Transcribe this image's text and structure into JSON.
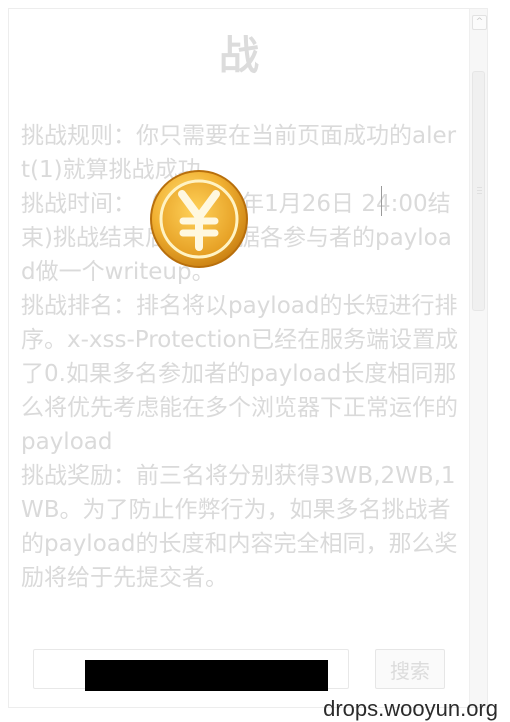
{
  "page": {
    "title": "战",
    "rules_text": "挑战规则：你只需要在当前页面成功的alert(1)就算挑战成功。\n挑战时间：  (于2014年1月26日 24:00结束)挑战结束后，将根据各参与者的payload做一个writeup。\n挑战排名：排名将以payload的长短进行排序。x-xss-Protection已经在服务端设置成了0.如果多名参加者的payload长度相同那么将优先考虑能在多个浏览器下正常运作的payload\n挑战奖励：前三名将分别获得3WB,2WB,1WB。为了防止作弊行为，如果多名挑战者的payload的长度和内容完全相同，那么奖励将给于先提交者。"
  },
  "search": {
    "value": "",
    "placeholder": "",
    "button_label": "搜索"
  },
  "watermark": "drops.wooyun.org",
  "icons": {
    "coin": "yuan-coin-icon",
    "scroll_up": "chevron-up-icon"
  },
  "colors": {
    "faded_text": "#dadada",
    "coin_gold": "#f2b233",
    "redaction": "#000000"
  }
}
